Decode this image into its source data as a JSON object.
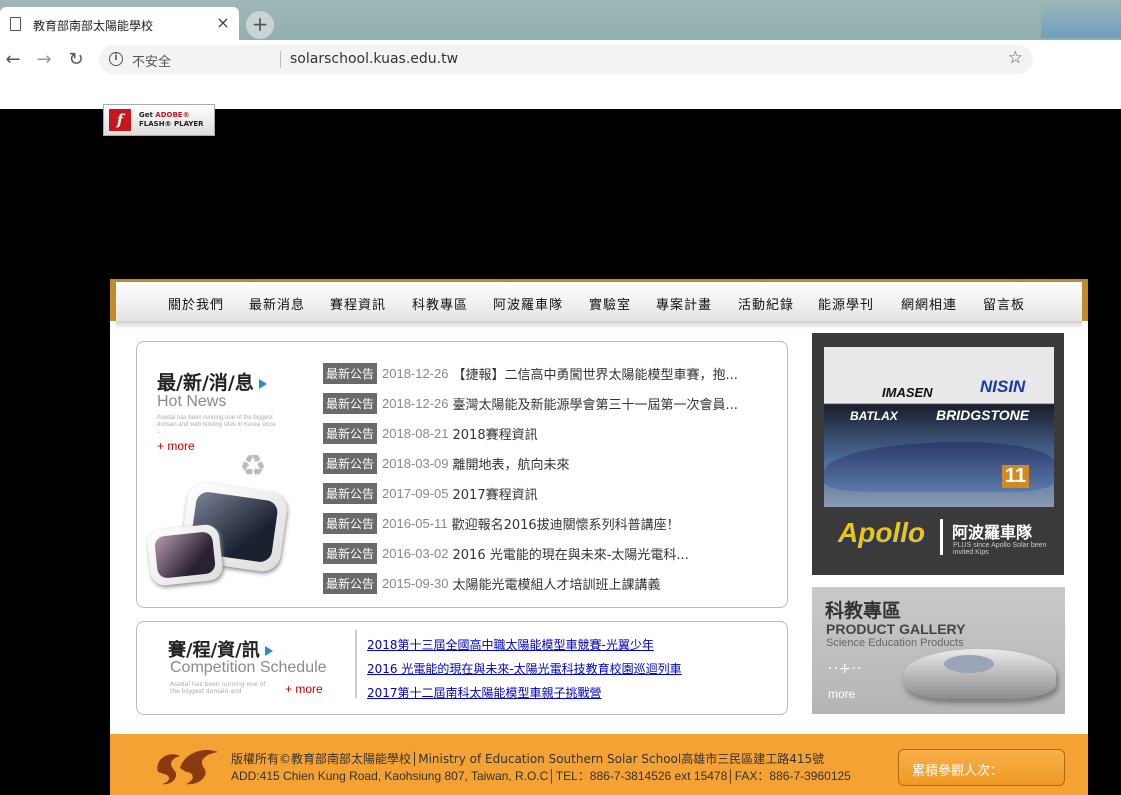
{
  "browser": {
    "tab_title": "教育部南部太陽能學校",
    "tab_close": "×",
    "new_tab": "+",
    "back": "←",
    "forward": "→",
    "reload": "↻",
    "security_icon": "i",
    "security_label": "不安全",
    "url": "solarschool.kuas.edu.tw",
    "bookmark": "☆"
  },
  "flash_badge": {
    "line1_prefix": "Get ",
    "line1_brand": "ADOBE®",
    "line2": "FLASH® PLAYER",
    "logo": "f"
  },
  "nav": {
    "items": [
      "關於我們",
      "最新消息",
      "賽程資訊",
      "科教專區",
      "阿波羅車隊",
      "實驗室",
      "專案計畫",
      "活動紀錄",
      "能源學刊",
      "網網相連",
      "留言板"
    ]
  },
  "news": {
    "heading": "最/新/消/息",
    "subheading": "Hot News",
    "blurb": "Asedal has been running one of the biggest domain and web hosting sites in Korea since ...",
    "more": "+ more",
    "badge": "最新公告",
    "items": [
      {
        "date": "2018-12-26",
        "title": "【捷報】二信高中勇闖世界太陽能模型車賽，抱..."
      },
      {
        "date": "2018-12-26",
        "title": "臺灣太陽能及新能源學會第三十一屆第一次會員..."
      },
      {
        "date": "2018-08-21",
        "title": "2018賽程資訊"
      },
      {
        "date": "2018-03-09",
        "title": "離開地表，航向未來"
      },
      {
        "date": "2017-09-05",
        "title": "2017賽程資訊"
      },
      {
        "date": "2016-05-11",
        "title": "歡迎報名2016拔迪關懷系列科普講座！"
      },
      {
        "date": "2016-03-02",
        "title": "2016 光電能的現在與未來-太陽光電科..."
      },
      {
        "date": "2015-09-30",
        "title": "太陽能光電模組人才培訓班上課講義"
      }
    ]
  },
  "schedule": {
    "heading": "賽/程/資/訊",
    "subheading": "Competition Schedule",
    "blurb": "Asedal has been running one of the biggest domain and",
    "more": "+ more",
    "links": [
      "2018第十三屆全國高中職太陽能模型車競賽-光翼少年",
      "2016 光電能的現在與未來-太陽光電科技教育校園巡迴列車",
      "2017第十二屆南科太陽能模型車親子挑戰營"
    ]
  },
  "apollo": {
    "photo_signs": [
      "IMASEN",
      "NISIN",
      "BATLAX",
      "BRIDGSTONE"
    ],
    "car_number": "11",
    "logo": "Apollo",
    "name": "阿波羅車隊",
    "tagline": "PLUS since Apollo Solar been invited Kips"
  },
  "gallery": {
    "title": "科教專區",
    "title_en": "PRODUCT GALLERY",
    "subtitle": "Science Education Products",
    "dots": "··+··",
    "more": "more"
  },
  "footer": {
    "line1": "版權所有©教育部南部太陽能學校│Ministry of Education Southern Solar School高雄市三民區建工路415號",
    "line2": "ADD:415 Chien Kung Road, Kaohsiung 807, Taiwan, R.O.C│TEL：886-7-3814526 ext 15478│FAX：886-7-3960125",
    "visitors_label": "累積參觀人次："
  },
  "colors": {
    "accent_orange": "#f5a234",
    "nav_border": "#c18a2c",
    "link_blue": "#0000cc",
    "more_red": "#cc0000"
  }
}
